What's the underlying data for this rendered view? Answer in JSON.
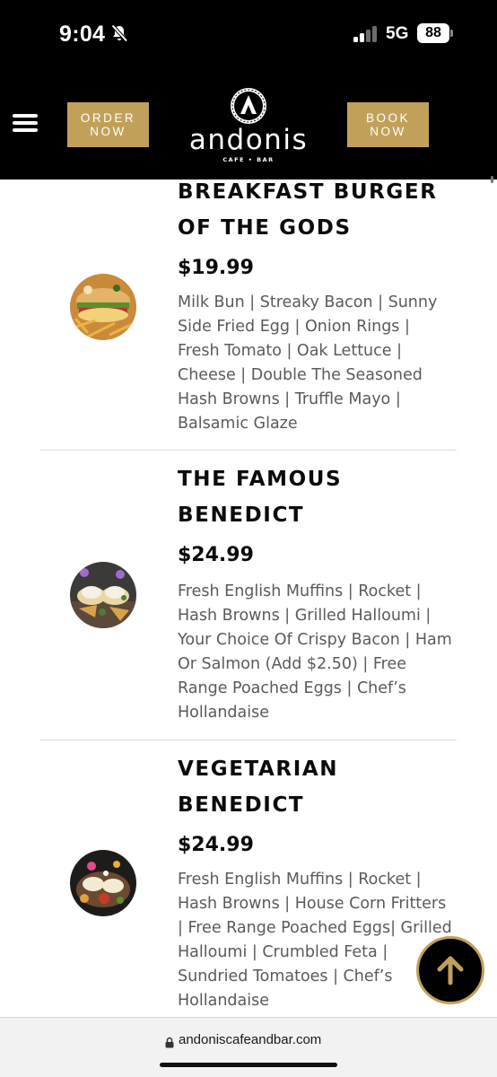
{
  "status_bar": {
    "time": "9:04",
    "network": "5G",
    "battery": "88",
    "icons": [
      "bell-slash-icon",
      "signal-icon",
      "battery-icon"
    ]
  },
  "header": {
    "order_button": {
      "line1": "ORDER",
      "line2": "NOW"
    },
    "book_button": {
      "line1": "BOOK",
      "line2": "NOW"
    },
    "logo_text": "andonis",
    "logo_subtext": "CAFE • BAR",
    "menu_icon": "hamburger-icon",
    "accent_color": "#c1a15a"
  },
  "menu_items": [
    {
      "name_line1": "BREAKFAST BURGER",
      "name_line2": "OF THE GODS",
      "price": "$19.99",
      "description": "Milk Bun | Streaky Bacon | Sunny Side Fried Egg | Onion Rings | Fresh Tomato | Oak Lettuce | Cheese | Double The Seasoned Hash Browns | Truffle Mayo | Balsamic Glaze"
    },
    {
      "name_line1": "THE FAMOUS",
      "name_line2": "BENEDICT",
      "price": "$24.99",
      "description": "Fresh English Muffins | Rocket | Hash Browns | Grilled Halloumi | Your Choice Of Crispy Bacon | Ham Or Salmon (Add $2.50) | Free Range Poached Eggs | Chef’s Hollandaise"
    },
    {
      "name_line1": "VEGETARIAN",
      "name_line2": "BENEDICT",
      "price": "$24.99",
      "description": "Fresh English Muffins | Rocket | Hash Browns | House Corn Fritters | Free Range Poached Eggs| Grilled Halloumi | Crumbled Feta | Sundried Tomatoes | Chef’s Hollandaise"
    }
  ],
  "scroll_top_icon": "arrow-up-icon",
  "browser": {
    "url": "andoniscafeandbar.com",
    "lock_icon": "lock-icon"
  }
}
